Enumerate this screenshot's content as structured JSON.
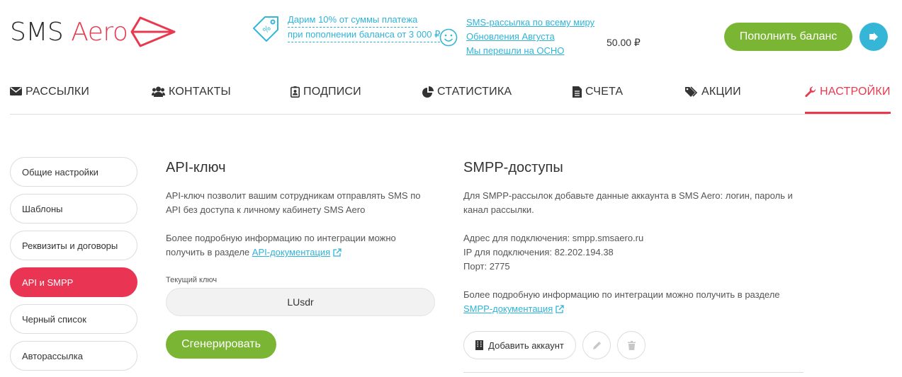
{
  "logo": {
    "part1": "SMS",
    "part2": "Aero"
  },
  "promo": {
    "line1": "Дарим 10% от суммы платежа",
    "line2": "при пополнении баланса от 3 000 ₽"
  },
  "news": [
    "SMS-рассылка по всему миру",
    "Обновления Августа",
    "Мы перешли на ОСНО"
  ],
  "balance": "50.00 ₽",
  "topup_label": "Пополнить баланс",
  "nav": [
    {
      "label": "РАССЫЛКИ",
      "icon": "envelope-icon"
    },
    {
      "label": "КОНТАКТЫ",
      "icon": "users-icon"
    },
    {
      "label": "ПОДПИСИ",
      "icon": "id-badge-icon"
    },
    {
      "label": "СТАТИСТИКА",
      "icon": "pie-chart-icon"
    },
    {
      "label": "СЧЕТА",
      "icon": "file-icon"
    },
    {
      "label": "АКЦИИ",
      "icon": "tags-icon"
    },
    {
      "label": "НАСТРОЙКИ",
      "icon": "wrench-icon",
      "active": true
    }
  ],
  "sidebar": [
    "Общие настройки",
    "Шаблоны",
    "Реквизиты и договоры",
    "API и SMPP",
    "Черный список",
    "Авторассылка"
  ],
  "api": {
    "title": "API-ключ",
    "desc": "API-ключ позволит вашим сотрудникам отправлять SMS по API без доступа к личному кабинету SMS Aero",
    "more_text": "Более подробную информацию по интеграции можно получить в разделе",
    "doc_link": "API-документация",
    "key_label": "Текущий ключ",
    "key_value": "LUsdr",
    "generate_label": "Сгенерировать"
  },
  "smpp": {
    "title": "SMPP-доступы",
    "desc": "Для SMPP-рассылок добавьте данные аккаунта в SMS Aero: логин, пароль и канал рассылки.",
    "address": "Адрес для подключения: smpp.smsaero.ru",
    "ip": "IP для подключения: 82.202.194.38",
    "port": "Порт: 2775",
    "more_text": "Более подробную информацию по интеграции можно получить в разделе",
    "doc_link": "SMPP-документация",
    "add_label": "Добавить аккаунт"
  },
  "colors": {
    "accent": "#e8394f",
    "green": "#7bb534",
    "link": "#2fb4d8"
  }
}
